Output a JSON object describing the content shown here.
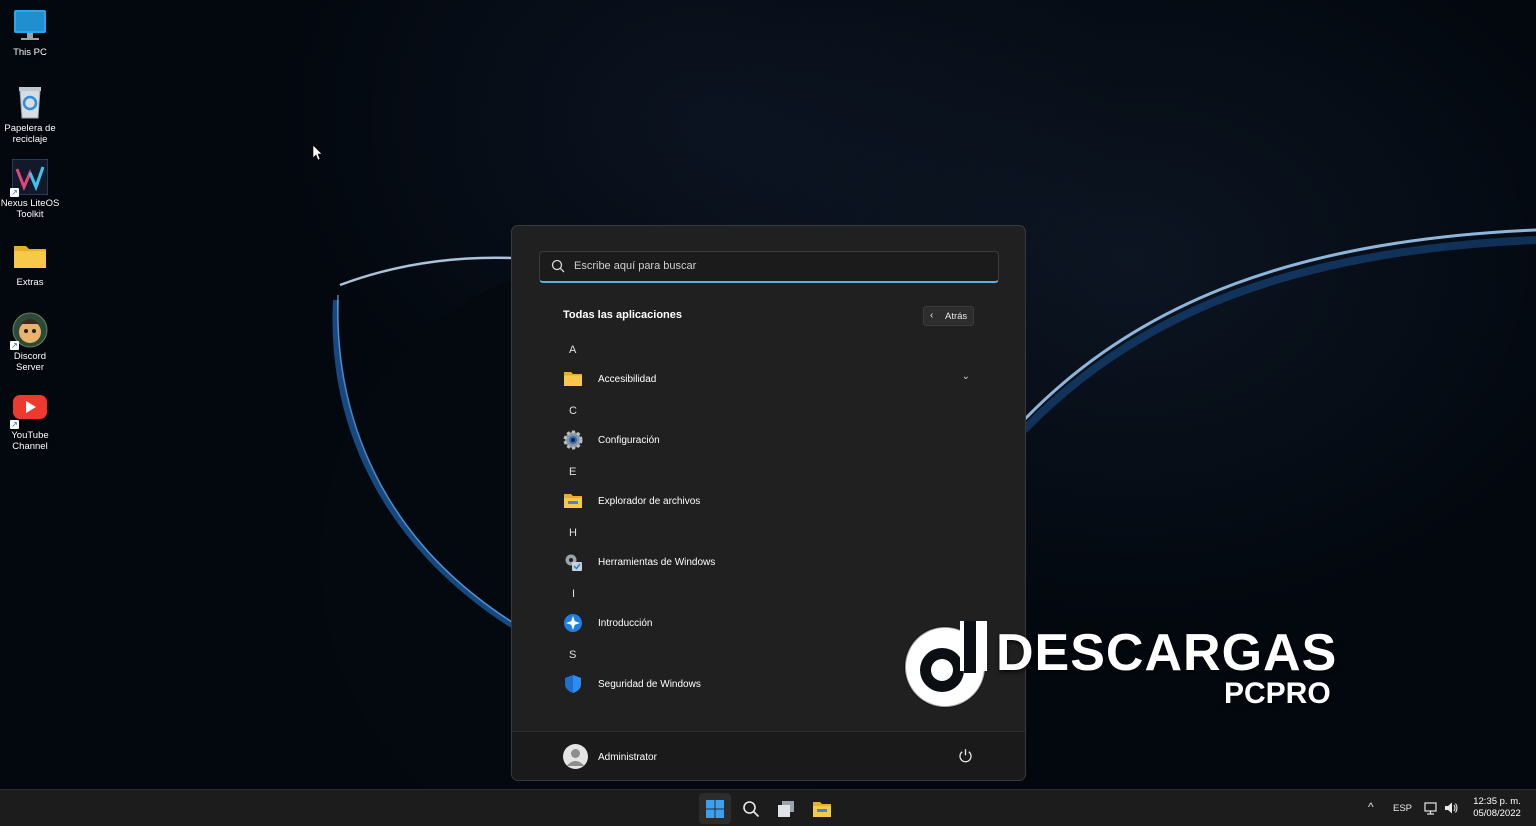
{
  "desktop": {
    "icons": [
      {
        "label": "This PC",
        "icon": "monitor-icon"
      },
      {
        "label": "Papelera de reciclaje",
        "icon": "recycle-bin-icon"
      },
      {
        "label": "Nexus LiteOS Toolkit",
        "icon": "nexus-toolkit-icon"
      },
      {
        "label": "Extras",
        "icon": "folder-icon"
      },
      {
        "label": "Discord Server",
        "icon": "discord-icon"
      },
      {
        "label": "YouTube Channel",
        "icon": "youtube-icon"
      }
    ]
  },
  "start_menu": {
    "search_placeholder": "Escribe aquí para buscar",
    "section_title": "Todas las aplicaciones",
    "back_label": "Atrás",
    "groups": [
      {
        "letter": "A",
        "app": "Accesibilidad",
        "icon": "folder-icon",
        "expandable": true
      },
      {
        "letter": "C",
        "app": "Configuración",
        "icon": "settings-gear-icon"
      },
      {
        "letter": "E",
        "app": "Explorador de archivos",
        "icon": "file-explorer-icon"
      },
      {
        "letter": "H",
        "app": "Herramientas de Windows",
        "icon": "windows-tools-icon"
      },
      {
        "letter": "I",
        "app": "Introducción",
        "icon": "get-started-icon"
      },
      {
        "letter": "S",
        "app": "Seguridad de Windows",
        "icon": "shield-icon"
      }
    ],
    "user_name": "Administrator"
  },
  "watermark": {
    "line1": "DESCARGAS",
    "line2": "PCPRO"
  },
  "taskbar": {
    "language": "ESP",
    "time": "12:35 p. m.",
    "date": "05/08/2022"
  },
  "colors": {
    "accent": "#5ab0e0",
    "start_bg": "#202020",
    "taskbar_bg": "#1c1c1c",
    "folder_yellow": "#f7c948",
    "windows_blue": "#3aa0f0"
  }
}
